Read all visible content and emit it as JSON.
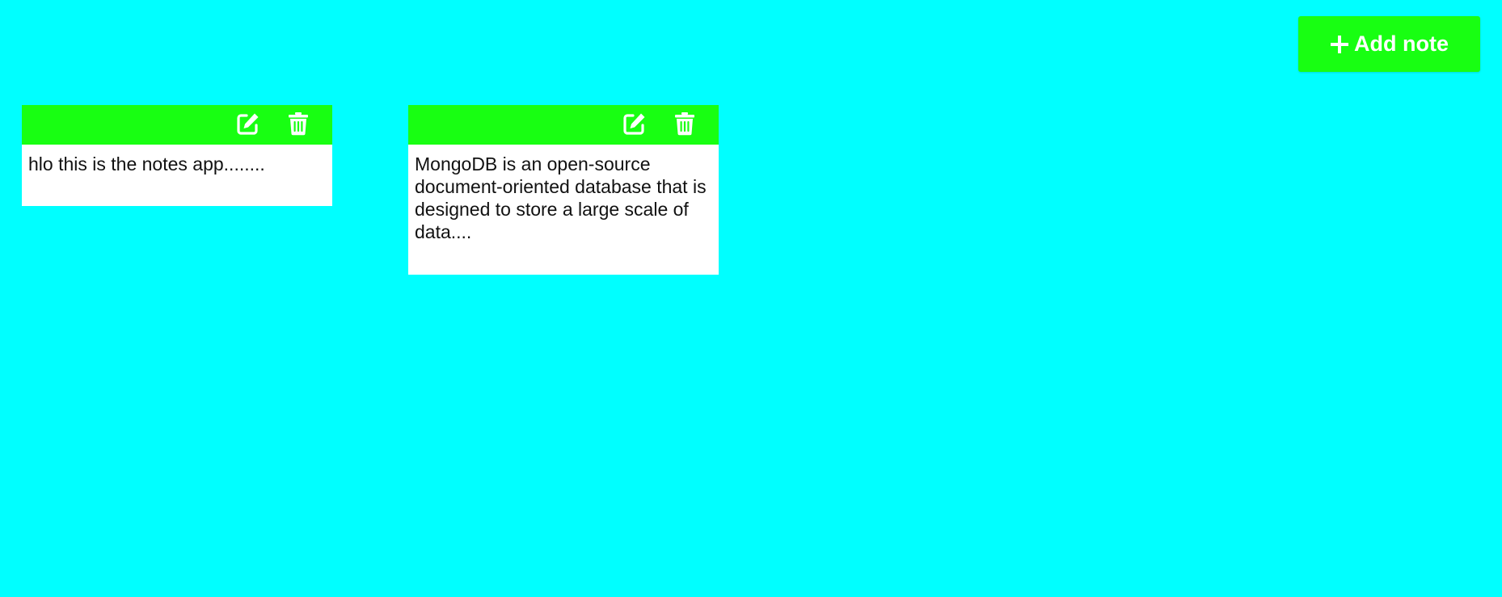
{
  "header": {
    "add_note_label": "Add note",
    "add_note_icon": "plus-icon"
  },
  "notes": [
    {
      "text": "hlo this is the notes app........",
      "edit_icon": "edit-icon",
      "delete_icon": "trash-icon"
    },
    {
      "text": "MongoDB is an open-source document-oriented database that is designed to store a large scale of data....",
      "edit_icon": "edit-icon",
      "delete_icon": "trash-icon"
    }
  ],
  "colors": {
    "background": "#00ffff",
    "accent": "#18ff12",
    "note_body": "#ffffff",
    "text": "#111111",
    "icon": "#ffffff"
  }
}
